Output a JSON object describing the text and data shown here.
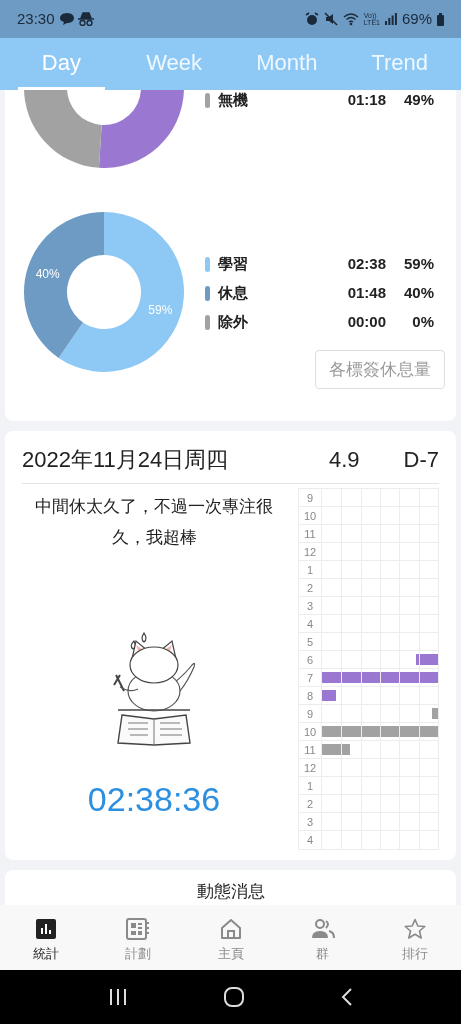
{
  "status_bar": {
    "time": "23:30",
    "volte_top": "Vo))",
    "volte_bottom": "LTE1",
    "battery": "69%"
  },
  "tabs": [
    {
      "label": "Day",
      "selected": true
    },
    {
      "label": "Week",
      "selected": false
    },
    {
      "label": "Month",
      "selected": false
    },
    {
      "label": "Trend",
      "selected": false
    }
  ],
  "tag_summary": {
    "chart_data": {
      "type": "donut",
      "values": [
        51,
        49
      ],
      "colors": [
        "#9a78d2",
        "#a2a2a2"
      ]
    },
    "legend": [
      {
        "label": "無機",
        "time": "01:18",
        "percent": "49%",
        "color": "#a2a2a2"
      }
    ]
  },
  "rest_summary": {
    "chart_data": {
      "type": "donut",
      "values": [
        59,
        40,
        0
      ],
      "value_labels": [
        "59%",
        "40%",
        null
      ]
    },
    "legend": [
      {
        "label": "學習",
        "time": "02:38",
        "percent": "59%",
        "color": "#8ec8f5"
      },
      {
        "label": "休息",
        "time": "01:48",
        "percent": "40%",
        "color": "#6e9bc4"
      },
      {
        "label": "除外",
        "time": "00:00",
        "percent": "0%",
        "color": "#a2a2a2"
      }
    ],
    "button": "各標簽休息量"
  },
  "day_card": {
    "date": "2022年11月24日周四",
    "score": "4.9",
    "countdown": "D-7",
    "note": "中間休太久了，不過一次專注很久，我超棒",
    "total_time": "02:38:36",
    "timeline": [
      {
        "hour": "9"
      },
      {
        "hour": "10"
      },
      {
        "hour": "11"
      },
      {
        "hour": "12"
      },
      {
        "hour": "1"
      },
      {
        "hour": "2"
      },
      {
        "hour": "3"
      },
      {
        "hour": "4"
      },
      {
        "hour": "5"
      },
      {
        "hour": "6",
        "fill": {
          "level": 0.19,
          "from_end": true,
          "color": "#9a78d2"
        }
      },
      {
        "hour": "7",
        "fill": {
          "level": 1,
          "color": "#9a78d2"
        }
      },
      {
        "hour": "8",
        "fill": {
          "level": 0.12,
          "from_end": false,
          "color": "#9a78d2"
        }
      },
      {
        "hour": "9",
        "fill": {
          "level": 0.05,
          "from_end": true,
          "color": "#a2a2a2"
        }
      },
      {
        "hour": "10",
        "fill": {
          "level": 1,
          "color": "#a2a2a2"
        }
      },
      {
        "hour": "11",
        "fill": {
          "level": 0.24,
          "from_end": false,
          "color": "#a2a2a2"
        }
      },
      {
        "hour": "12"
      },
      {
        "hour": "1"
      },
      {
        "hour": "2"
      },
      {
        "hour": "3"
      },
      {
        "hour": "4"
      }
    ]
  },
  "feed_card": {
    "title": "動態消息"
  },
  "bottom_nav": [
    {
      "label": "統計",
      "selected": true
    },
    {
      "label": "計劃",
      "selected": false
    },
    {
      "label": "主頁",
      "selected": false
    },
    {
      "label": "群",
      "selected": false
    },
    {
      "label": "排行",
      "selected": false
    }
  ]
}
